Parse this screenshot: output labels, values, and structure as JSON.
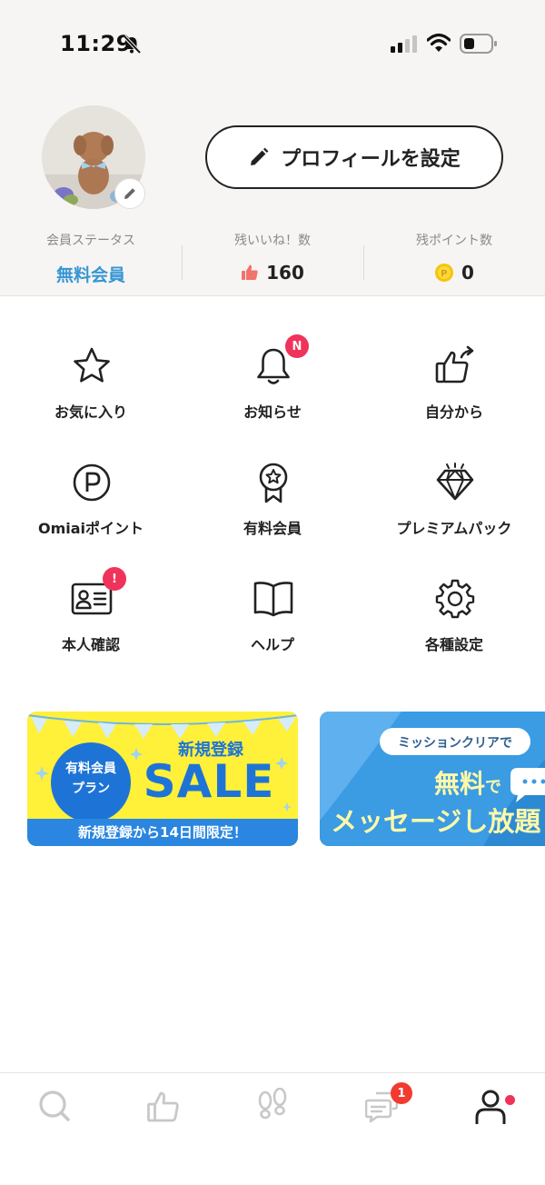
{
  "status_bar": {
    "time": "11:29"
  },
  "profile": {
    "set_profile_label": "プロフィールを設定"
  },
  "stats": [
    {
      "label": "会員ステータス",
      "value": "無料会員"
    },
    {
      "label": "残いいね！数",
      "value": "160"
    },
    {
      "label": "残ポイント数",
      "value": "0"
    }
  ],
  "menu": [
    {
      "label": "お気に入り",
      "icon": "star-icon"
    },
    {
      "label": "お知らせ",
      "icon": "bell-icon",
      "badge": "N"
    },
    {
      "label": "自分から",
      "icon": "thumb-share-icon"
    },
    {
      "label": "Omiaiポイント",
      "icon": "points-icon"
    },
    {
      "label": "有料会員",
      "icon": "ribbon-icon"
    },
    {
      "label": "プレミアムパック",
      "icon": "diamond-icon"
    },
    {
      "label": "本人確認",
      "icon": "id-card-icon",
      "badge": "!"
    },
    {
      "label": "ヘルプ",
      "icon": "book-icon"
    },
    {
      "label": "各種設定",
      "icon": "gear-icon"
    }
  ],
  "banners": {
    "sale": {
      "circle_line1": "有料会員",
      "circle_line2": "プラン",
      "subtitle": "新規登録",
      "title": "SALE",
      "footer": "新規登録から14日間限定！"
    },
    "mission": {
      "tag": "ミッションクリアで",
      "line1_main": "無料",
      "line1_suffix": "で",
      "line2": "メッセージし放題"
    }
  },
  "bottom_nav": {
    "messages_badge": "1"
  },
  "colors": {
    "accent_blue": "#3796d4",
    "badge_red": "#f0335a",
    "header_bg": "#f6f5f3"
  }
}
